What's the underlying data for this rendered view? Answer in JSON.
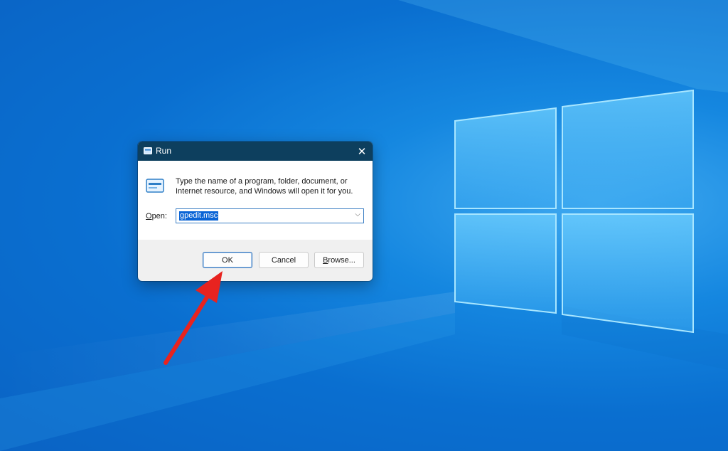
{
  "dialog": {
    "title": "Run",
    "close_symbol": "✕",
    "description": "Type the name of a program, folder, document, or Internet resource, and Windows will open it for you.",
    "open_label_prefix": "O",
    "open_label_rest": "pen:",
    "input_value": "gpedit.msc",
    "ok_label": "OK",
    "cancel_label": "Cancel",
    "browse_label_prefix": "B",
    "browse_label_rest": "rowse..."
  },
  "icons": {
    "title_icon": "run-icon",
    "content_icon": "run-icon",
    "dropdown": "chevron-down-icon",
    "close": "close-icon",
    "annotation": "red-arrow"
  },
  "colors": {
    "titlebar": "#0d3f5e",
    "selection": "#0a64d6",
    "arrow": "#e8231f",
    "desktop": "#1587e0"
  }
}
